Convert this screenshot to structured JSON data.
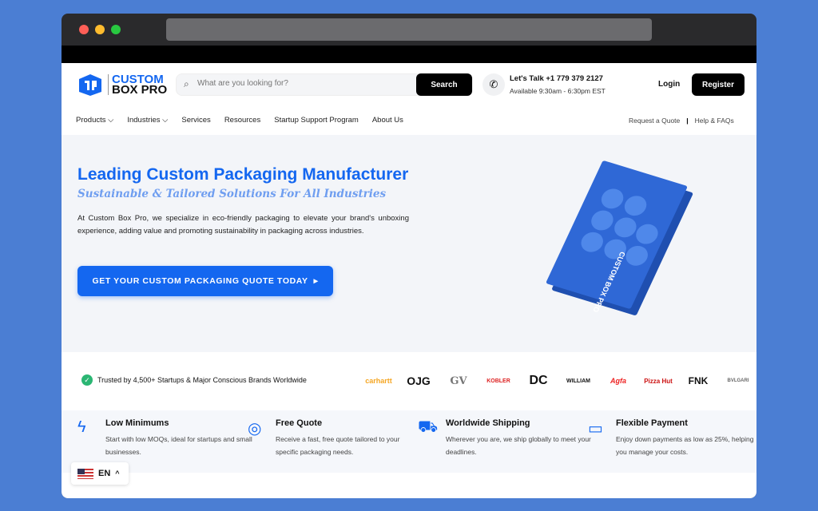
{
  "browser": {
    "traffic_colors": [
      "#fe5f57",
      "#febc2e",
      "#28c840"
    ]
  },
  "header": {
    "logo_line1": "CUSTOM",
    "logo_line2": "BOX PRO",
    "search_placeholder": "What are you looking for?",
    "search_button": "Search",
    "phone_title": "Let's Talk +1 779 379 2127",
    "phone_hours": "Available 9:30am - 6:30pm EST",
    "login": "Login",
    "register": "Register"
  },
  "nav": {
    "items": [
      {
        "label": "Products",
        "dropdown": true
      },
      {
        "label": "Industries",
        "dropdown": true
      },
      {
        "label": "Services"
      },
      {
        "label": "Resources"
      },
      {
        "label": "Startup Support Program"
      },
      {
        "label": "About Us"
      }
    ],
    "right": [
      "Request a Quote",
      "Help & FAQs"
    ]
  },
  "hero": {
    "title": "Leading Custom Packaging Manufacturer",
    "subtitle": "Sustainable & Tailored Solutions For All Industries",
    "description": "At Custom Box Pro, we specialize in eco-friendly packaging to elevate your brand's unboxing experience, adding value and promoting sustainability in packaging across industries.",
    "cta": "GET YOUR CUSTOM PACKAGING QUOTE TODAY",
    "box_text": "CUSTOM BOX PRO"
  },
  "trust": {
    "text": "Trusted by 4,500+ Startups & Major Conscious Brands Worldwide",
    "brands": [
      "carhartt",
      "OJG",
      "GV",
      "KOBLER",
      "DC",
      "WILLIAM",
      "Agfa",
      "Pizza Hut",
      "FNK",
      "BVLGARI"
    ]
  },
  "features": [
    {
      "icon": "lightning-icon",
      "title": "Low Minimums",
      "desc": "Start with low MOQs, ideal for startups and small businesses."
    },
    {
      "icon": "lifebuoy-icon",
      "title": "Free Quote",
      "desc": "Receive a fast, free quote tailored to your specific packaging needs."
    },
    {
      "icon": "truck-icon",
      "title": "Worldwide Shipping",
      "desc": "Wherever you are, we ship globally to meet your deadlines."
    },
    {
      "icon": "credit-card-icon",
      "title": "Flexible Payment",
      "desc": "Enjoy down payments as low as 25%, helping you manage your costs."
    }
  ],
  "language": {
    "code": "EN"
  },
  "colors": {
    "accent": "#1467f0",
    "background": "#4b7ed3"
  }
}
